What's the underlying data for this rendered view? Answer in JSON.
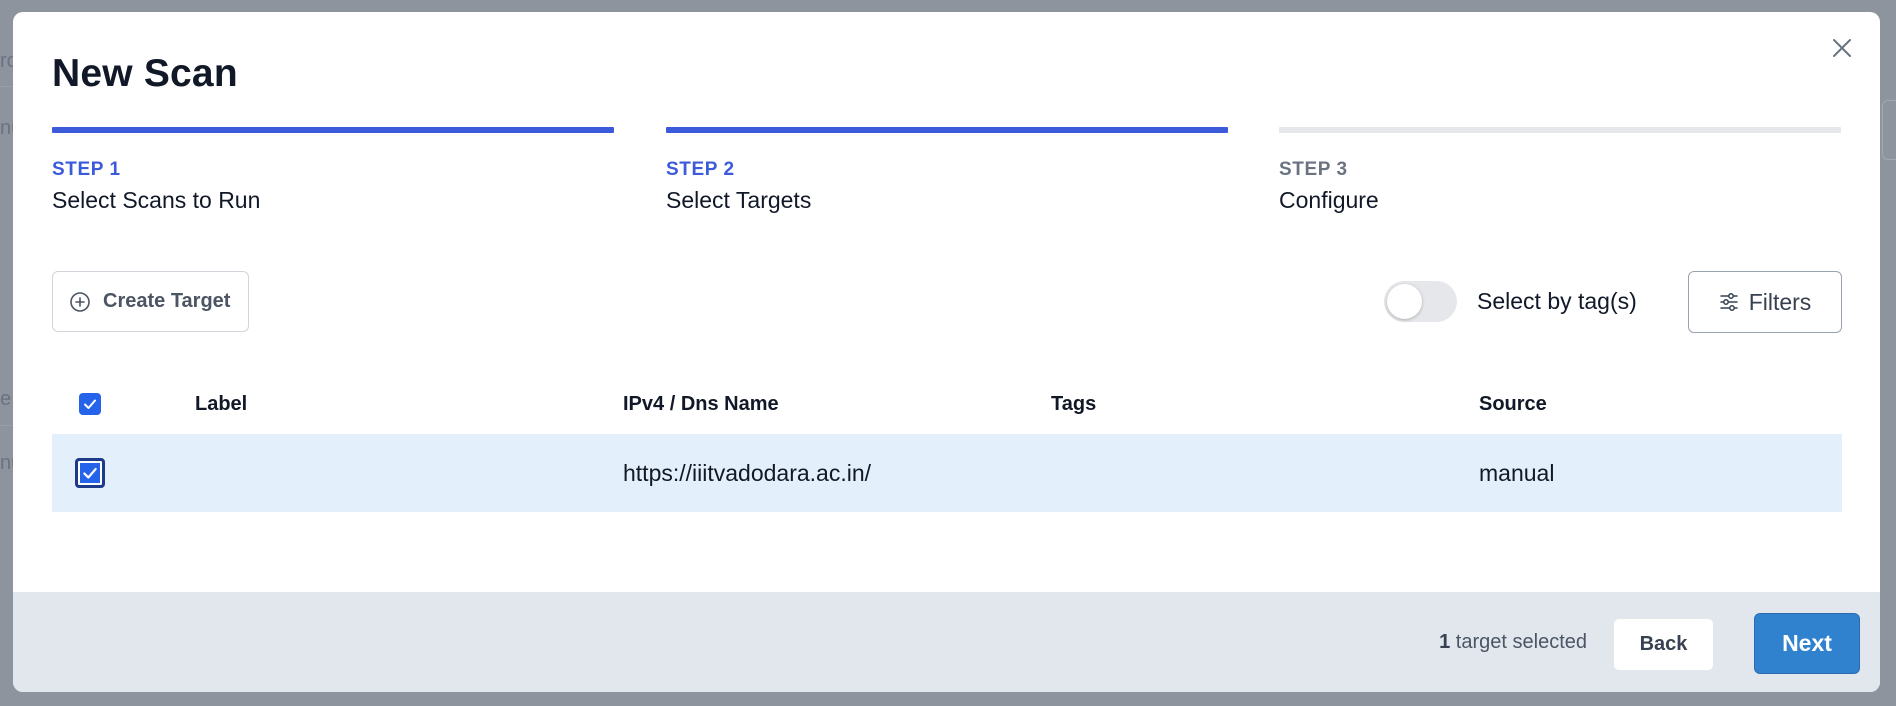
{
  "modal": {
    "title": "New Scan"
  },
  "steps": [
    {
      "number": "STEP 1",
      "name": "Select Scans to Run",
      "state": "complete"
    },
    {
      "number": "STEP 2",
      "name": "Select Targets",
      "state": "current"
    },
    {
      "number": "STEP 3",
      "name": "Configure",
      "state": "upcoming"
    }
  ],
  "toolbar": {
    "create_label": "Create Target",
    "toggle_label": "Select by tag(s)",
    "toggle_on": false,
    "filters_label": "Filters"
  },
  "table": {
    "columns": [
      "Label",
      "IPv4 / Dns Name",
      "Tags",
      "Source"
    ],
    "header_checked": true,
    "rows": [
      {
        "checked": true,
        "label": "",
        "host": "https://iiitvadodara.ac.in/",
        "tags": "",
        "source": "manual"
      }
    ]
  },
  "footer": {
    "selected_count": "1",
    "selected_suffix": " target selected",
    "back_label": "Back",
    "next_label": "Next"
  },
  "colors": {
    "accent": "#3b5bdb",
    "primary_button": "#3182ce",
    "row_highlight": "#e3effa"
  }
}
